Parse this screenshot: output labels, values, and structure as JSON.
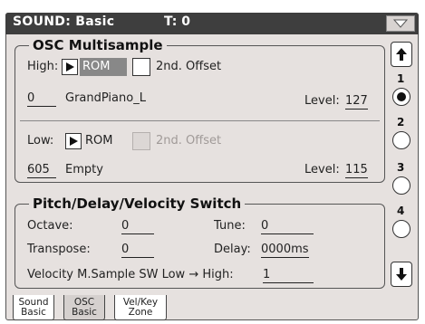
{
  "title_bar": {
    "title": "SOUND: Basic",
    "timbre": "T: 0"
  },
  "osc_panel": {
    "title": "OSC Multisample",
    "high": {
      "label": "High:",
      "source": "ROM",
      "offset_label": "2nd. Offset",
      "number": "0",
      "name": "GrandPiano_L",
      "level_label": "Level:",
      "level": "127"
    },
    "low": {
      "label": "Low:",
      "source": "ROM",
      "offset_label": "2nd. Offset",
      "number": "605",
      "name": "Empty",
      "level_label": "Level:",
      "level": "115"
    }
  },
  "pitch_panel": {
    "title": "Pitch/Delay/Velocity Switch",
    "octave_label": "Octave:",
    "octave": "0",
    "tune_label": "Tune:",
    "tune": "0",
    "transpose_label": "Transpose:",
    "transpose": "0",
    "delay_label": "Delay:",
    "delay": "0000ms",
    "velocity_label": "Velocity M.Sample SW Low → High:",
    "velocity": "1"
  },
  "scrollbar": {
    "layers": [
      "1",
      "2",
      "3",
      "4"
    ],
    "selected_layer": "1"
  },
  "tabs": [
    {
      "line1": "Sound",
      "line2": "Basic"
    },
    {
      "line1": "OSC",
      "line2": "Basic"
    },
    {
      "line1": "Vel/Key",
      "line2": "Zone"
    }
  ]
}
